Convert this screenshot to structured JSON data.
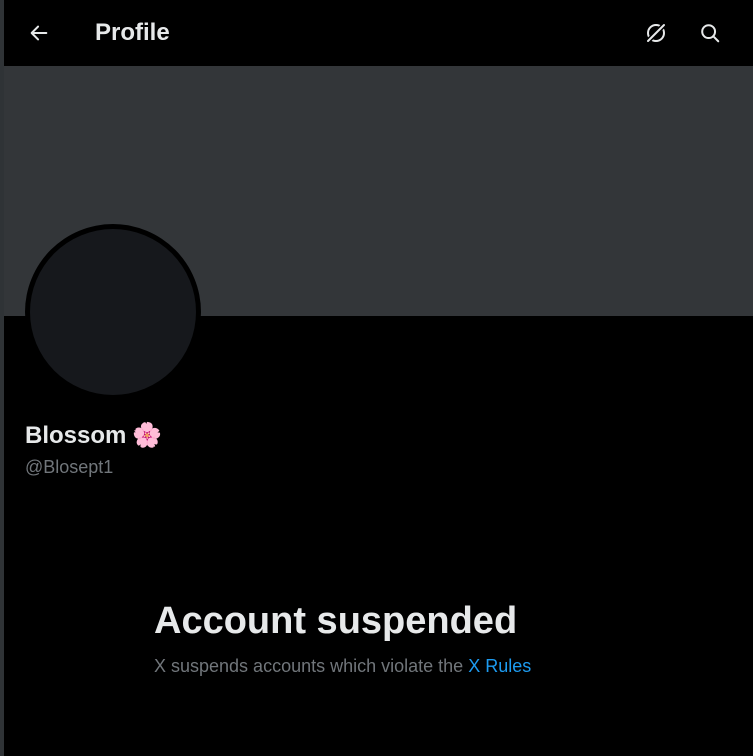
{
  "header": {
    "title": "Profile",
    "back_icon": "arrow-left-icon",
    "grok_icon": "grok-icon",
    "search_icon": "search-icon"
  },
  "profile": {
    "display_name": "Blossom",
    "name_emoji": "🌸",
    "handle": "@Blosept1"
  },
  "suspension": {
    "title": "Account suspended",
    "message": "X suspends accounts which violate the",
    "rules_link": "X Rules"
  },
  "colors": {
    "background": "#000000",
    "banner": "#333639",
    "link": "#1d9bf0",
    "secondary_text": "#71767b"
  }
}
